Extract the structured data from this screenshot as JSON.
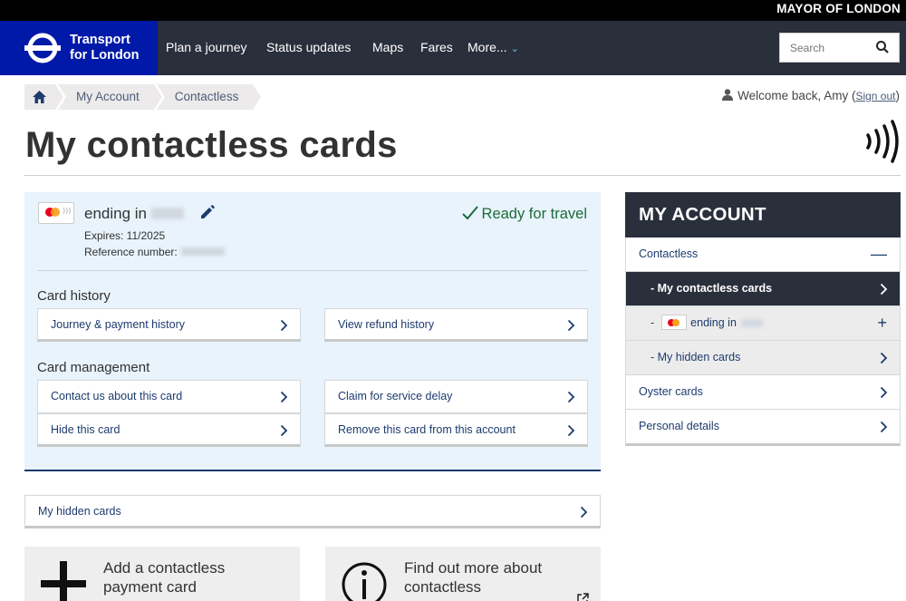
{
  "header": {
    "mayor": "MAYOR OF LONDON",
    "logo_line1": "Transport",
    "logo_line2": "for London",
    "nav": [
      "Plan a journey",
      "Status updates",
      "Maps",
      "Fares",
      "More..."
    ],
    "search_placeholder": "Search"
  },
  "breadcrumb": {
    "items": [
      "My Account",
      "Contactless"
    ]
  },
  "user": {
    "welcome": "Welcome back, Amy",
    "sign_out": "Sign out"
  },
  "page": {
    "title": "My contactless cards"
  },
  "card": {
    "ending_label": "ending in",
    "status": "Ready for travel",
    "expires": "Expires: 11/2025",
    "reference_label": "Reference number:"
  },
  "card_history": {
    "heading": "Card history",
    "links": [
      "Journey & payment history",
      "View refund history"
    ]
  },
  "card_management": {
    "heading": "Card management",
    "links": [
      "Contact us about this card",
      "Claim for service delay",
      "Hide this card",
      "Remove this card from this account"
    ]
  },
  "hidden_cards_link": "My hidden cards",
  "promos": {
    "add_line1": "Add a contactless",
    "add_line2": "payment card",
    "find_line1": "Find out more about",
    "find_line2": "contactless"
  },
  "sidebar": {
    "title": "MY ACCOUNT",
    "contactless": "Contactless",
    "my_cards": "- My contactless cards",
    "card_prefix": "-",
    "card_ending": "ending in",
    "hidden_cards": "- My hidden cards",
    "oyster": "Oyster cards",
    "personal": "Personal details"
  },
  "colors": {
    "tfl_blue": "#0019a8",
    "nav_dark": "#2a2f3c",
    "link": "#1d3b6e",
    "ready_green": "#1d6b3a"
  }
}
